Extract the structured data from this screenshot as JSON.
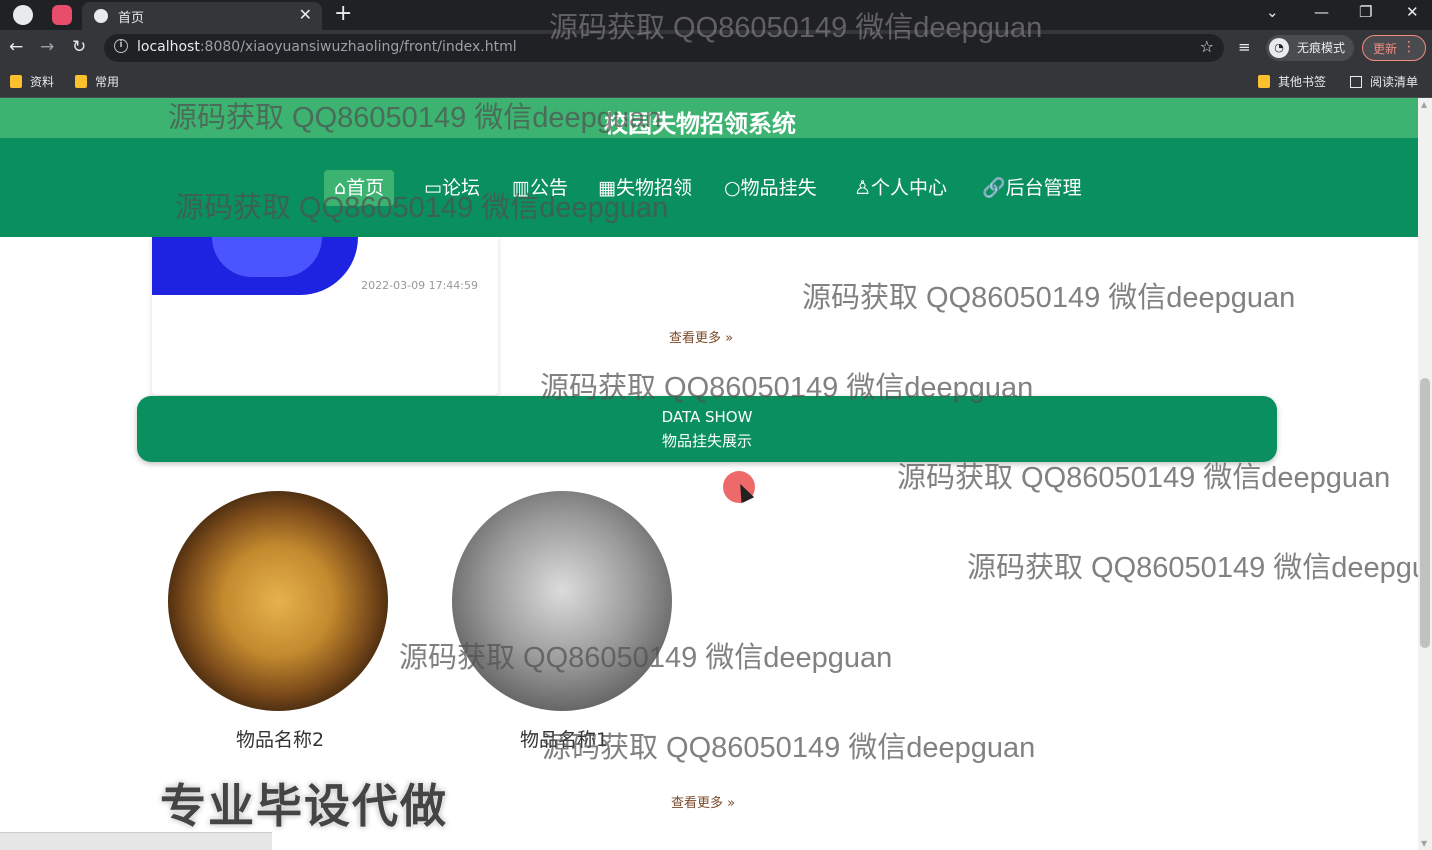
{
  "browser": {
    "tab_title": "首页",
    "url_host": "localhost",
    "url_path": ":8080/xiaoyuansiwuzhaoling/front/index.html",
    "incognito_label": "无痕模式",
    "update_label": "更新",
    "bookmarks": [
      "资料",
      "常用"
    ],
    "other_bookmarks": "其他书签",
    "reading_list": "阅读清单"
  },
  "site": {
    "title": "校园失物招领系统",
    "nav": [
      {
        "icon": "home-icon",
        "label": "首页"
      },
      {
        "icon": "chat-icon",
        "label": "论坛"
      },
      {
        "icon": "news-icon",
        "label": "公告"
      },
      {
        "icon": "grid-icon",
        "label": "失物招领"
      },
      {
        "icon": "circle-icon",
        "label": "物品挂失"
      },
      {
        "icon": "user-icon",
        "label": "个人中心"
      },
      {
        "icon": "link-icon",
        "label": "后台管理"
      }
    ],
    "active_nav": "首页"
  },
  "card": {
    "date": "2022-03-09 17:44:59"
  },
  "more_label": "查看更多",
  "banner": {
    "en": "DATA SHOW",
    "cn": "物品挂失展示"
  },
  "items": [
    {
      "name": "物品名称2"
    },
    {
      "name": "物品名称1"
    }
  ],
  "watermark": "源码获取 QQ86050149 微信deepguan",
  "promo": "专业毕设代做",
  "colors": {
    "header": "#3cb371",
    "nav": "#0a8f5f",
    "banner": "#0a8f5f"
  }
}
